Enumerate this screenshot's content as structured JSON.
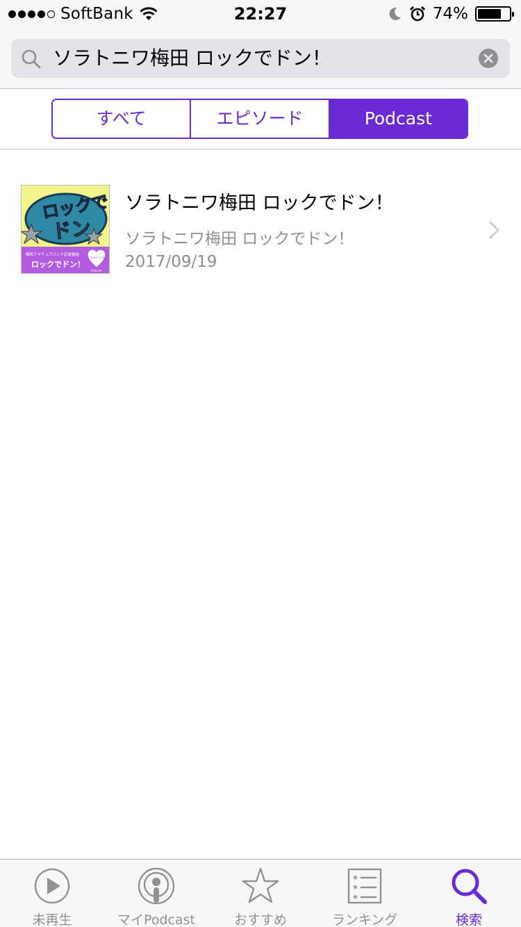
{
  "status_bar": {
    "carrier": "SoftBank",
    "time": "22:27",
    "battery_percent": "74%",
    "battery_level": 0.74
  },
  "search": {
    "query": "ソラトニワ梅田 ロックでドン！",
    "icon": "search-icon",
    "clear_icon": "clear-icon"
  },
  "segments": {
    "items": [
      {
        "label": "すべて",
        "selected": false
      },
      {
        "label": "エピソード",
        "selected": false
      },
      {
        "label": "Podcast",
        "selected": true
      }
    ]
  },
  "results": [
    {
      "title": "ソラトニワ梅田 ロックでドン！",
      "subtitle": "ソラトニワ梅田 ロックでドン！",
      "date": "2017/09/19",
      "artwork": {
        "top_text": "ロックで",
        "main_text": "ドン",
        "band_text_small": "関西アマチュアバンド応援番組",
        "band_text": "ロックでドン！",
        "logo_text": "SORA TO NIWA",
        "bottom_right_text": "Podcast"
      }
    }
  ],
  "tab_bar": {
    "items": [
      {
        "label": "未再生",
        "icon": "play-circle-icon",
        "active": false
      },
      {
        "label": "マイPodcast",
        "icon": "podcast-icon",
        "active": false
      },
      {
        "label": "おすすめ",
        "icon": "star-icon",
        "active": false
      },
      {
        "label": "ランキング",
        "icon": "ranking-list-icon",
        "active": false
      },
      {
        "label": "検索",
        "icon": "search-icon",
        "active": true
      }
    ]
  },
  "colors": {
    "accent": "#6b2ad4",
    "secondary_text": "#8e8e93",
    "tab_inactive": "#929292"
  }
}
